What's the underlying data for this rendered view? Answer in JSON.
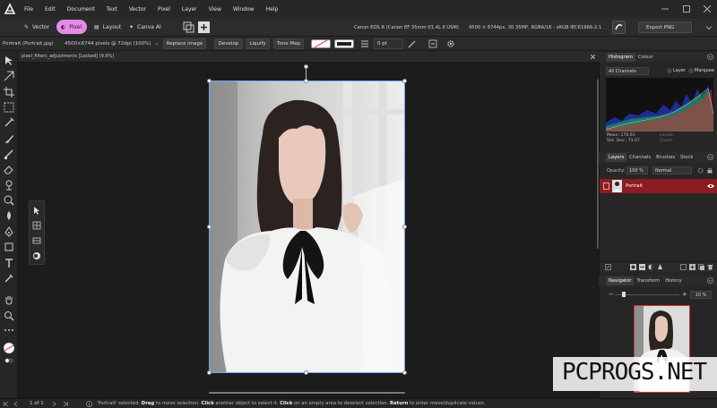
{
  "menubar": {
    "items": [
      "File",
      "Edit",
      "Document",
      "Text",
      "Vector",
      "Pixel",
      "Layer",
      "View",
      "Window",
      "Help"
    ]
  },
  "toolbar": {
    "personas": [
      {
        "label": "Vector",
        "active": false
      },
      {
        "label": "Pixel",
        "active": true
      },
      {
        "label": "Layout",
        "active": false
      },
      {
        "label": "Canva AI",
        "active": false
      }
    ],
    "camera_info": "Canon EOS R (Canon EF 35mm f/1.4L II USM)",
    "pixel_info": "4500 × 6744px, 30.35MP, RGBA/16 - sRGB IEC61966-2.1",
    "export_label": "Export PNG"
  },
  "context_bar": {
    "file_label": "Portrait (Portrait.jpg)",
    "dimensions": "4500×6744 pixels @ 72dpi (100%)",
    "buttons": [
      "Replace image",
      "Develop",
      "Liquify",
      "Tone Map"
    ],
    "stroke_width": "0 pt"
  },
  "document": {
    "tab_title": "pixel_filters_adjustments [Locked] (9.9%)"
  },
  "histogram_panel": {
    "tabs": [
      "Histogram",
      "Colour"
    ],
    "channel": "All Channels",
    "options": [
      "Layer",
      "Marquee"
    ],
    "mean": "Mean: 176.93",
    "std_dev": "Std. Dev.: 73.67",
    "levels": "Levels:",
    "count": "Count:"
  },
  "layers_panel": {
    "tabs": [
      "Layers",
      "Channels",
      "Brushes",
      "Stock"
    ],
    "opacity_label": "Opacity:",
    "opacity_value": "100 %",
    "blend_mode": "Normal",
    "layers": [
      {
        "name": "Portrait",
        "selected": true
      }
    ]
  },
  "navigator_panel": {
    "tabs": [
      "Navigator",
      "Transform",
      "History"
    ],
    "zoom": "10 %"
  },
  "status": {
    "page": "1 of 1",
    "message_parts": [
      {
        "text": "'Portrait' selected. ",
        "bold": false
      },
      {
        "text": "Drag",
        "bold": true
      },
      {
        "text": " to move selection. ",
        "bold": false
      },
      {
        "text": "Click",
        "bold": true
      },
      {
        "text": " another object to select it. ",
        "bold": false
      },
      {
        "text": "Click",
        "bold": true
      },
      {
        "text": " on an empty area to deselect selection. ",
        "bold": false
      },
      {
        "text": "Return",
        "bold": true
      },
      {
        "text": " to enter move/duplicate values.",
        "bold": false
      }
    ]
  },
  "watermark": "PCPROGS.NET",
  "colors": {
    "accent_pink": "#e48be7",
    "layer_selected": "#8b1c22",
    "panel_bg": "#262626"
  }
}
